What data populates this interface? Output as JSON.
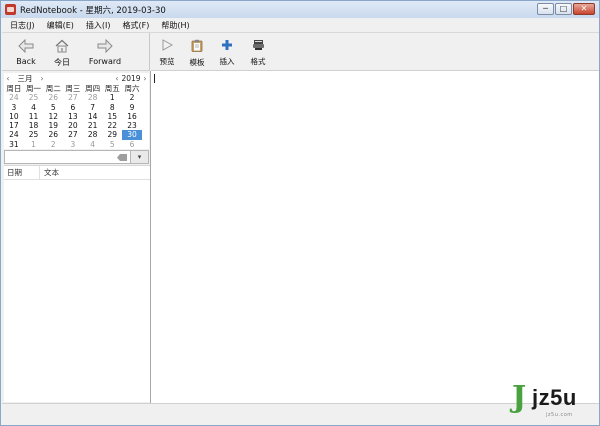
{
  "window": {
    "title": "RedNotebook - 星期六, 2019-03-30",
    "controls": {
      "minimize": "─",
      "maximize": "□",
      "close": "✕"
    }
  },
  "menu": [
    "日志(J)",
    "编辑(E)",
    "插入(I)",
    "格式(F)",
    "帮助(H)"
  ],
  "nav": {
    "back": "Back",
    "today": "今日",
    "forward": "Forward"
  },
  "toolbar": {
    "preview": "预览",
    "template": "模板",
    "insert": "插入",
    "format": "格式"
  },
  "calendar": {
    "month": "三月",
    "year": "2019",
    "weekdays": [
      "周日",
      "周一",
      "周二",
      "周三",
      "周四",
      "周五",
      "周六"
    ],
    "weeks": [
      [
        "24",
        "25",
        "26",
        "27",
        "28",
        "1",
        "2"
      ],
      [
        "3",
        "4",
        "5",
        "6",
        "7",
        "8",
        "9"
      ],
      [
        "10",
        "11",
        "12",
        "13",
        "14",
        "15",
        "16"
      ],
      [
        "17",
        "18",
        "19",
        "20",
        "21",
        "22",
        "23"
      ],
      [
        "24",
        "25",
        "26",
        "27",
        "28",
        "29",
        "30"
      ],
      [
        "31",
        "1",
        "2",
        "3",
        "4",
        "5",
        "6"
      ]
    ],
    "selected_day": "30"
  },
  "results": {
    "col_date": "日期",
    "col_text": "文本"
  },
  "watermark": {
    "brand_j": "J",
    "brand_rest": "jz5u",
    "sub": "jz5u.com"
  },
  "colors": {
    "selected_day": "#4a90d9",
    "accent_red": "#c0392b",
    "watermark_green": "#4aa23f"
  }
}
